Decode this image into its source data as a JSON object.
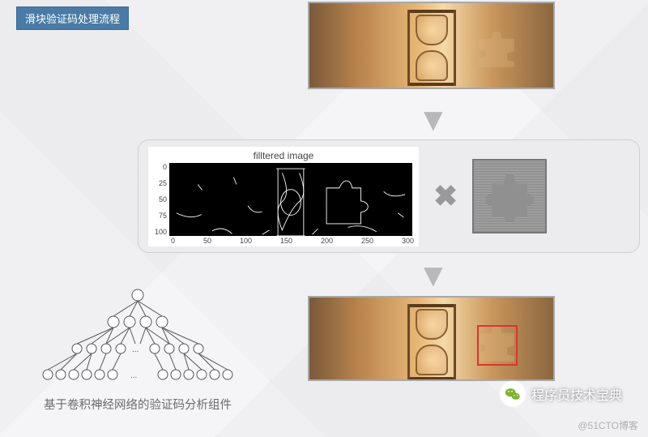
{
  "title": "滑块验证码处理流程",
  "stage2": {
    "chart_title": "filltered image",
    "multiply_symbol": "✖"
  },
  "cnn_caption": "基于卷积神经网络的验证码分析组件",
  "wechat_name": "程序员技术宝典",
  "watermark": "@51CTO博客",
  "chart_data": {
    "type": "heatmap",
    "title": "filltered image",
    "xlabel": "",
    "ylabel": "",
    "x_ticks": [
      0,
      50,
      100,
      150,
      200,
      250,
      300
    ],
    "y_ticks": [
      0,
      25,
      50,
      75,
      100
    ],
    "xlim": [
      0,
      340
    ],
    "ylim": [
      0,
      110
    ],
    "note": "Binary edge-detected captcha image (Canny-like). White = edge, black = background. Values are pixel intensities; figure shown as image, not numeric grid."
  },
  "diagram": {
    "steps": [
      "原始滑块验证码图像 (hourglass photo with puzzle-piece gap)",
      "边缘滤波图 × 滑块模板 — template matching",
      "CNN 验证码分析组件",
      "定位滑块目标位置 (red bounding box on original image)"
    ]
  },
  "icons": {
    "arrow_down": "▼",
    "multiply": "✖"
  }
}
